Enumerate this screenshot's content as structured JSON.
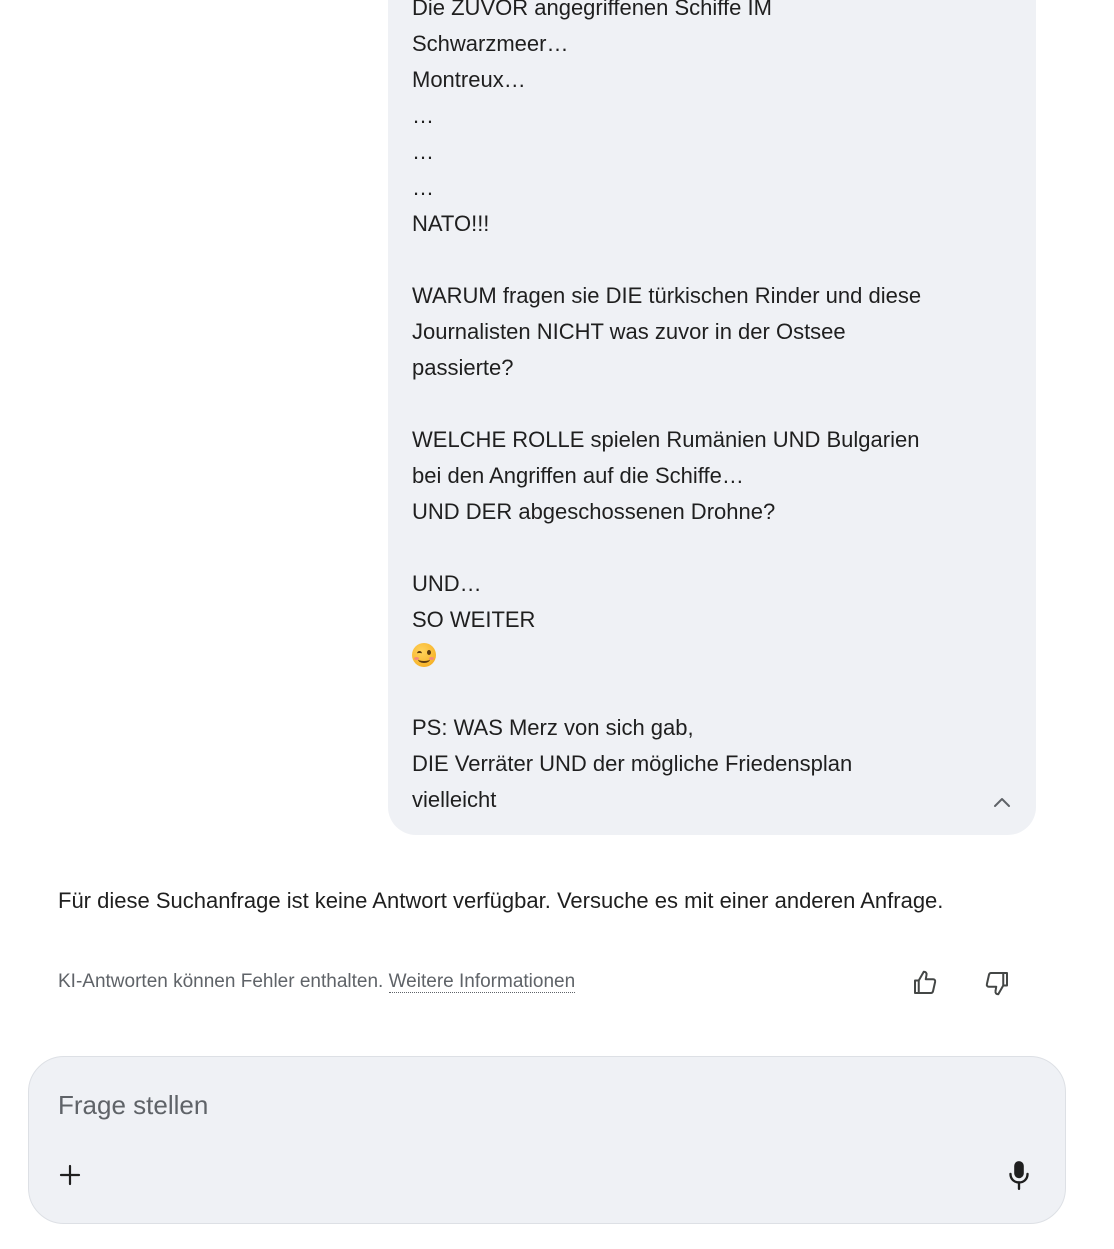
{
  "user_message": {
    "lines": [
      "Die ZUVOR angegriffenen Schiffe IM",
      "Schwarzmeer…",
      "Montreux…",
      "…",
      "…",
      "…",
      "NATO!!!",
      "",
      "WARUM fragen sie DIE türkischen Rinder und diese",
      "Journalisten NICHT was zuvor in der Ostsee",
      "passierte?",
      "",
      "WELCHE ROLLE spielen Rumänien UND Bulgarien",
      "bei den Angriffen auf die Schiffe…",
      "UND DER abgeschossenen Drohne?",
      "",
      "UND…",
      "SO WEITER",
      "",
      "",
      "PS: WAS Merz von sich gab,",
      "DIE Verräter UND der mögliche Friedensplan",
      "vielleicht"
    ],
    "emoji": "winking-face-emoji",
    "collapse_icon": "chevron-up-icon"
  },
  "answer": {
    "text": "Für diese Suchanfrage ist keine Antwort verfügbar. Versuche es mit einer anderen Anfrage."
  },
  "footer": {
    "disclaimer": "KI-Antworten können Fehler enthalten.",
    "more_info_link": "Weitere Informationen",
    "thumbs_up_icon": "thumbs-up-icon",
    "thumbs_down_icon": "thumbs-down-icon"
  },
  "ask_box": {
    "placeholder": "Frage stellen",
    "value": "",
    "plus_icon": "plus-icon",
    "mic_icon": "microphone-icon"
  },
  "colors": {
    "bubble_bg": "#eff1f5",
    "text": "#1f1f1f",
    "muted": "#5f6368"
  }
}
